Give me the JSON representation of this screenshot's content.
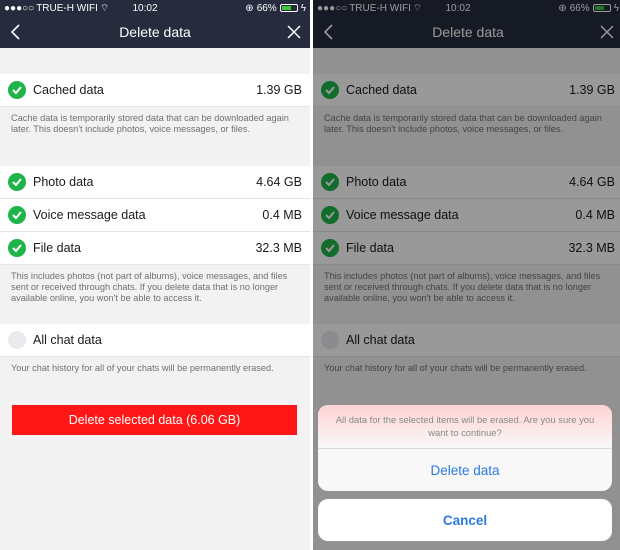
{
  "status_bar": {
    "carrier": "TRUE-H WIFI",
    "time": "10:02",
    "battery": "66%",
    "battery_level": 0.66
  },
  "nav": {
    "title": "Delete data"
  },
  "cache": {
    "label": "Cached data",
    "value": "1.39 GB",
    "note": "Cache data is temporarily stored data that can be downloaded again later. This doesn't include photos, voice messages, or files."
  },
  "media": [
    {
      "label": "Photo data",
      "value": "4.64 GB"
    },
    {
      "label": "Voice message data",
      "value": "0.4 MB"
    },
    {
      "label": "File data",
      "value": "32.3 MB"
    }
  ],
  "media_note": "This includes photos (not part of albums), voice messages, and files sent or received through chats. If you delete data that is no longer available online, you won't be able to access it.",
  "chat": {
    "label": "All chat data",
    "note": "Your chat history for all of your chats will be permanently erased."
  },
  "delete_button": "Delete selected data (6.06 GB)",
  "action_sheet": {
    "message": "All data for the selected items will be erased. Are you sure you want to continue?",
    "confirm": "Delete data",
    "cancel": "Cancel"
  },
  "colors": {
    "nav_bg": "#262c3d",
    "check_green": "#1fb44a",
    "delete_red": "#ff1717",
    "action_blue": "#2c7ae0"
  }
}
